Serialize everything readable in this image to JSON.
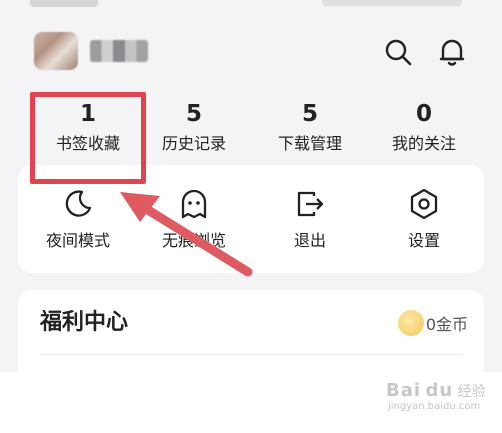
{
  "header": {
    "avatar_icon": "user-avatar",
    "search_icon": "search-icon",
    "bell_icon": "bell-icon"
  },
  "stats": [
    {
      "value": "1",
      "label": "书签收藏"
    },
    {
      "value": "5",
      "label": "历史记录"
    },
    {
      "value": "5",
      "label": "下载管理"
    },
    {
      "value": "0",
      "label": "我的关注"
    }
  ],
  "tools": [
    {
      "label": "夜间模式",
      "icon": "moon-icon"
    },
    {
      "label": "无痕浏览",
      "icon": "ghost-icon"
    },
    {
      "label": "退出",
      "icon": "exit-icon"
    },
    {
      "label": "设置",
      "icon": "settings-icon"
    }
  ],
  "welfare": {
    "title": "福利中心",
    "coins": "0金币"
  },
  "watermark": {
    "text": "Bai",
    "paw": "du",
    "suffix": "经验",
    "url": "jingyan.baidu.com"
  },
  "colors": {
    "highlight": "#e0444e",
    "arrow": "#e05a62"
  }
}
